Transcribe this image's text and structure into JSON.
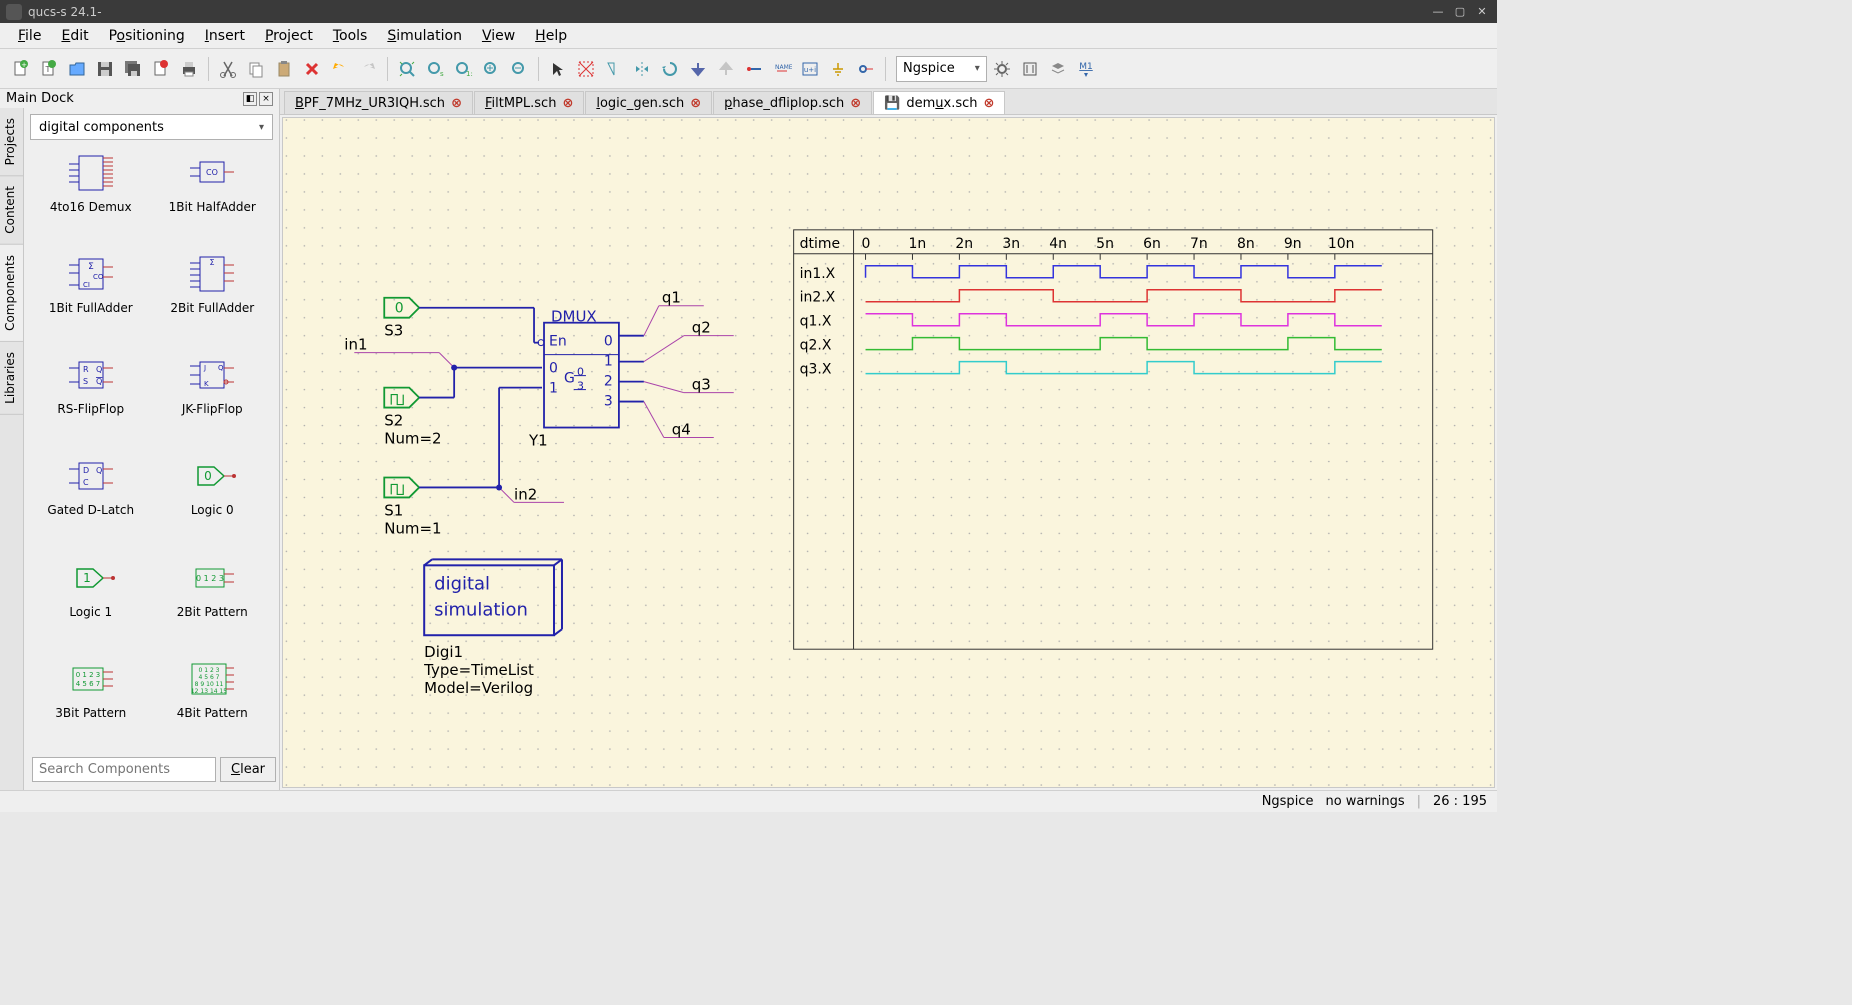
{
  "title": "qucs-s 24.1-",
  "menus": [
    "File",
    "Edit",
    "Positioning",
    "Insert",
    "Project",
    "Tools",
    "Simulation",
    "View",
    "Help"
  ],
  "simulator": "Ngspice",
  "dock_title": "Main Dock",
  "side_tabs": [
    "Projects",
    "Content",
    "Components",
    "Libraries"
  ],
  "active_side_tab": 2,
  "combo": "digital components",
  "components": [
    "4to16 Demux",
    "1Bit HalfAdder",
    "1Bit FullAdder",
    "2Bit FullAdder",
    "RS-FlipFlop",
    "JK-FlipFlop",
    "Gated D-Latch",
    "Logic 0",
    "Logic 1",
    "2Bit Pattern",
    "3Bit Pattern",
    "4Bit Pattern"
  ],
  "search_placeholder": "Search Components",
  "clear_label": "Clear",
  "doc_tabs": [
    {
      "label": "BPF_7MHz_UR3IQH.sch",
      "u": "B",
      "rest": "PF_7MHz_UR3IQH.sch"
    },
    {
      "label": "FiltMPL.sch",
      "u": "F",
      "rest": "iltMPL.sch"
    },
    {
      "label": "logic_gen.sch",
      "u": "l",
      "rest": "ogic_gen.sch"
    },
    {
      "label": "phase_dfliplop.sch",
      "u": "p",
      "rest": "hase_dfliplop.sch"
    },
    {
      "label": "demux.sch",
      "u": "u",
      "rest": "",
      "pre": "dem",
      "post": "x.sch",
      "active": true,
      "unsaved": true
    }
  ],
  "schematic": {
    "labels": {
      "in1": "in1",
      "in2": "in2",
      "q1": "q1",
      "q2": "q2",
      "q3": "q3",
      "q4": "q4",
      "S1": "S1",
      "S1N": "Num=1",
      "S2": "S2",
      "S2N": "Num=2",
      "S3": "S3",
      "DMUX": "DMUX",
      "En": "En",
      "G": "G",
      "Y1": "Y1",
      "sim_title": "digital",
      "sim_title2": "simulation",
      "Digi1": "Digi1",
      "Type": "Type=TimeList",
      "Model": "Model=Verilog"
    },
    "timing": {
      "header": "dtime",
      "ticks": [
        "0",
        "1n",
        "2n",
        "3n",
        "4n",
        "5n",
        "6n",
        "7n",
        "8n",
        "9n",
        "10n"
      ],
      "signals": [
        "in1.X",
        "in2.X",
        "q1.X",
        "q2.X",
        "q3.X"
      ]
    }
  },
  "status": {
    "sim": "Ngspice",
    "warn": "no warnings",
    "coord": "26 : 195"
  }
}
